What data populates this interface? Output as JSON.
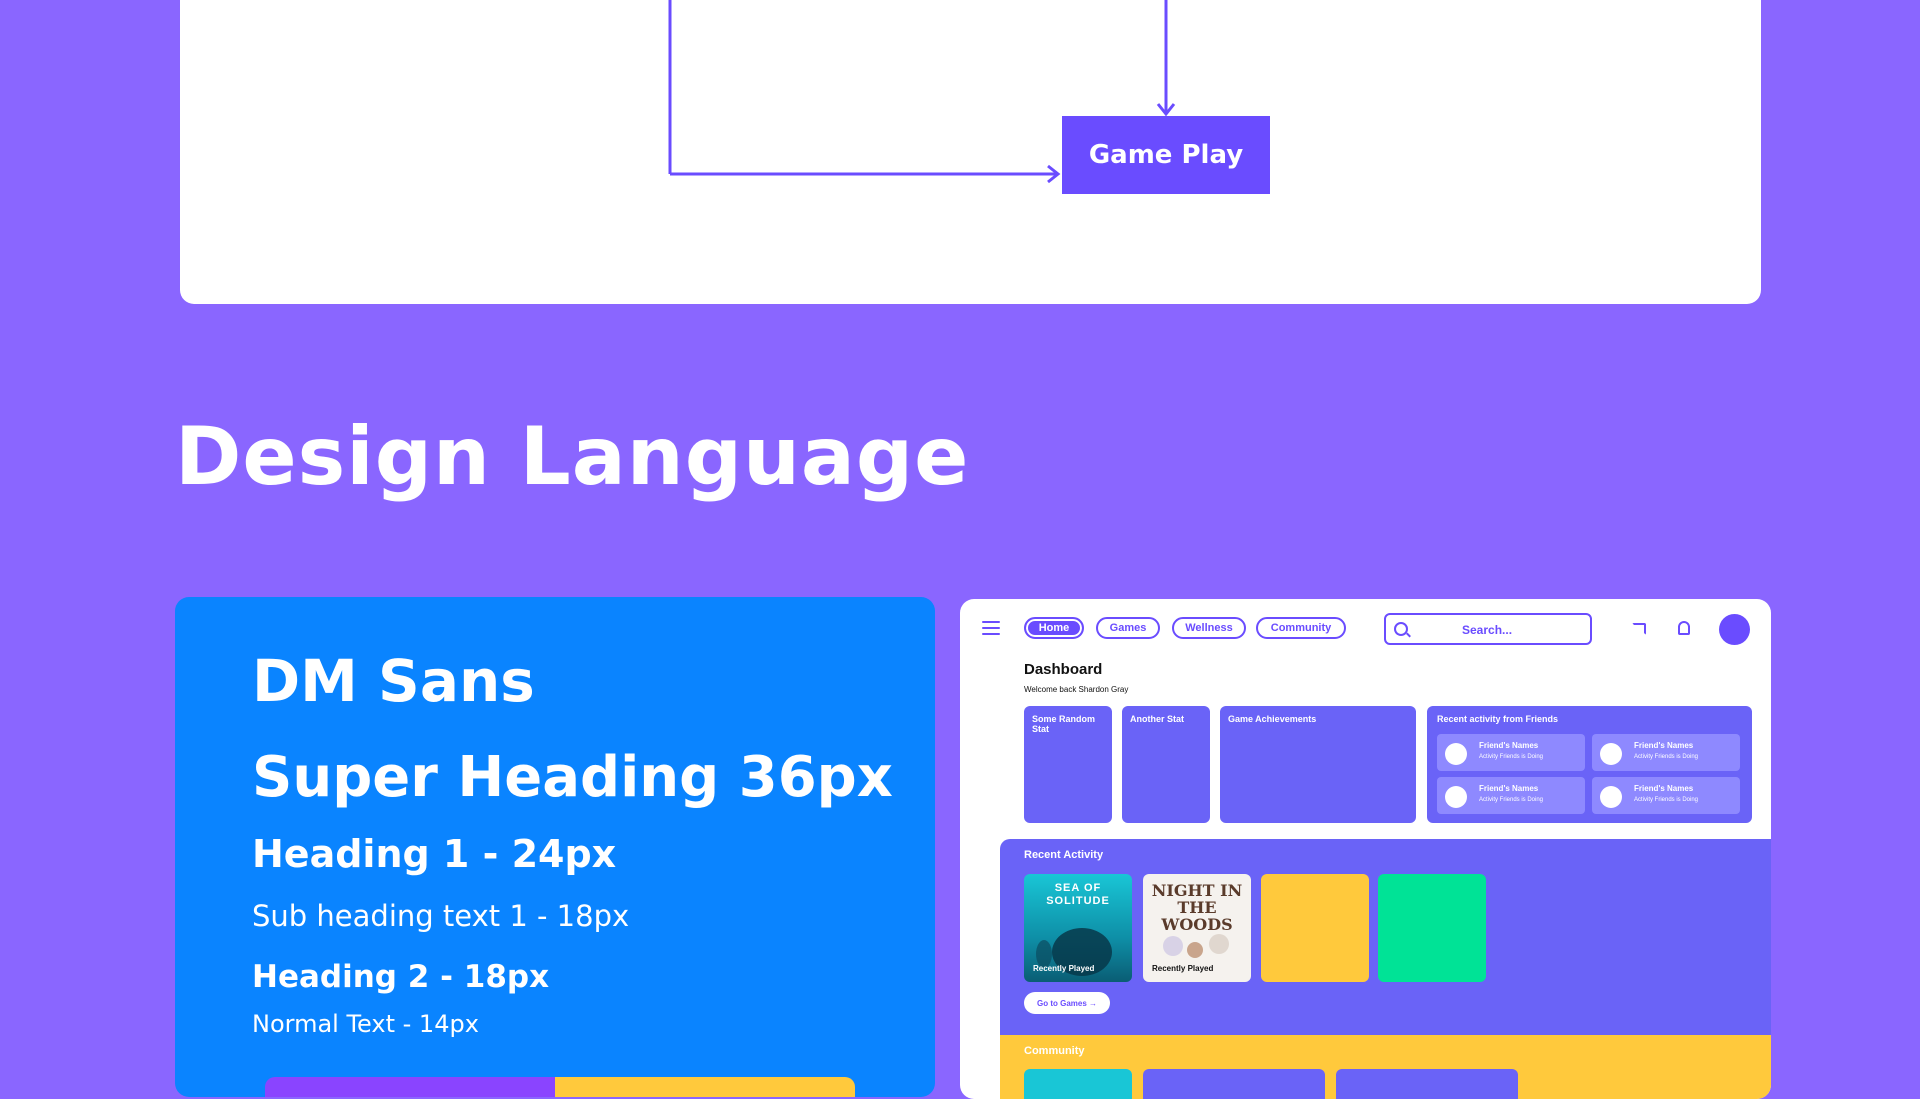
{
  "flow": {
    "box_label": "Game Play"
  },
  "section_title": "Design Language",
  "typography": {
    "font_name": "DM Sans",
    "super_heading": "Super Heading 36px",
    "heading1": "Heading 1 - 24px",
    "subheading": "Sub heading text 1 - 18px",
    "heading2": "Heading 2 - 18px",
    "normal": "Normal Text - 14px"
  },
  "colors": {
    "background": "#8a66ff",
    "primary": "#6a4cff",
    "blue": "#0a84ff",
    "yellow": "#ffc93c",
    "green": "#00e396",
    "purple": "#8a44ff"
  },
  "dashboard": {
    "nav": [
      "Home",
      "Games",
      "Wellness",
      "Community"
    ],
    "active_nav": "Home",
    "search_placeholder": "Search...",
    "title": "Dashboard",
    "welcome": "Welcome back Shardon Gray",
    "stats": [
      "Some Random Stat",
      "Another Stat",
      "Game Achievements"
    ],
    "friends_title": "Recent activity from Friends",
    "friends": [
      {
        "name": "Friend's Names",
        "activity": "Activity Friends is Doing"
      },
      {
        "name": "Friend's Names",
        "activity": "Activity Friends is Doing"
      },
      {
        "name": "Friend's Names",
        "activity": "Activity Friends is Doing"
      },
      {
        "name": "Friend's Names",
        "activity": "Activity Friends is Doing"
      }
    ],
    "recent_title": "Recent Activity",
    "games": [
      {
        "title": "SEA OF SOLITUDE",
        "label": "Recently Played"
      },
      {
        "title": "NIGHT IN THE WOODS",
        "label": "Recently Played"
      }
    ],
    "go_button": "Go to Games →",
    "community_title": "Community",
    "icons": [
      "menu-icon",
      "search-icon",
      "cast-icon",
      "bell-icon"
    ]
  }
}
